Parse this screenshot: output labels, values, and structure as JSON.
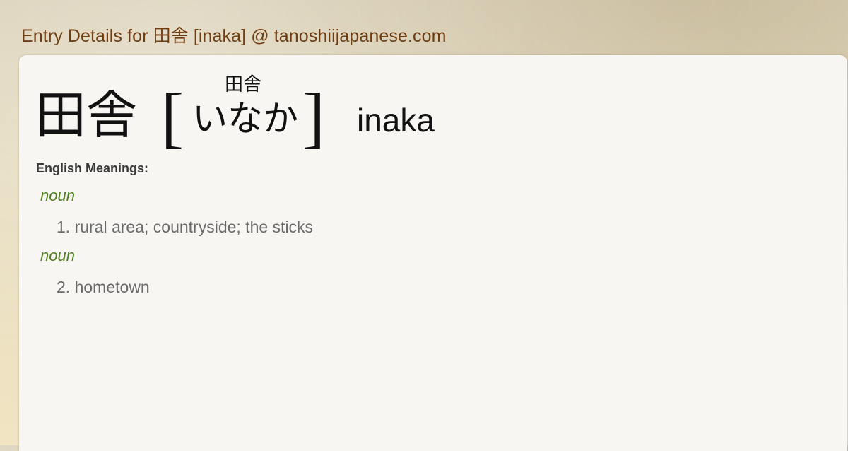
{
  "header": {
    "title": "Entry Details for 田舎 [inaka] @ tanoshiijapanese.com"
  },
  "entry": {
    "headword": "田舎",
    "bracket_open": "[",
    "bracket_close": "]",
    "ruby_kanji": "田舎",
    "reading": "いなか",
    "romaji": "inaka",
    "meanings_label": "English Meanings:",
    "senses": [
      {
        "pos": "noun",
        "definition": "1. rural area; countryside; the sticks"
      },
      {
        "pos": "noun",
        "definition": "2. hometown"
      }
    ]
  },
  "colors": {
    "header_text": "#6e3d12",
    "pos_text": "#4f7f1e",
    "definition_text": "#6a6a6a",
    "card_background": "#f7f6f2"
  }
}
